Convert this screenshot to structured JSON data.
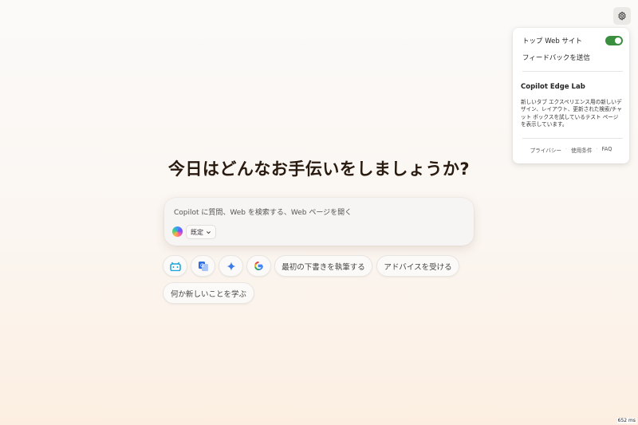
{
  "settings": {
    "icon": "gear-icon"
  },
  "panel": {
    "top_sites_label": "トップ Web サイト",
    "top_sites_enabled": true,
    "feedback_label": "フィードバックを送信",
    "lab_title": "Copilot Edge Lab",
    "lab_description": "新しいタブ エクスペリエンス用の新しいデザイン、レイアウト、更新された検索/チャット ボックスを試しているテスト ページを表示しています。",
    "footer": {
      "privacy": "プライバシー",
      "terms": "使用条件",
      "faq": "FAQ"
    }
  },
  "headline": "今日はどんなお手伝いをしましょうか?",
  "chat": {
    "placeholder": "Copilot に質問、Web を検索する、Web ページを開く",
    "mode_label": "既定",
    "mode_icon": "chevron-down-icon"
  },
  "chips": {
    "icons": [
      "bilibili-icon",
      "translate-icon",
      "sparkle-icon",
      "google-icon"
    ],
    "draft": "最初の下書きを執筆する",
    "advice": "アドバイスを受ける",
    "learn": "何か新しいことを学ぶ"
  },
  "perf": "652 ms",
  "colors": {
    "toggle_on": "#3a8f3f",
    "headline": "#2a1b10"
  }
}
